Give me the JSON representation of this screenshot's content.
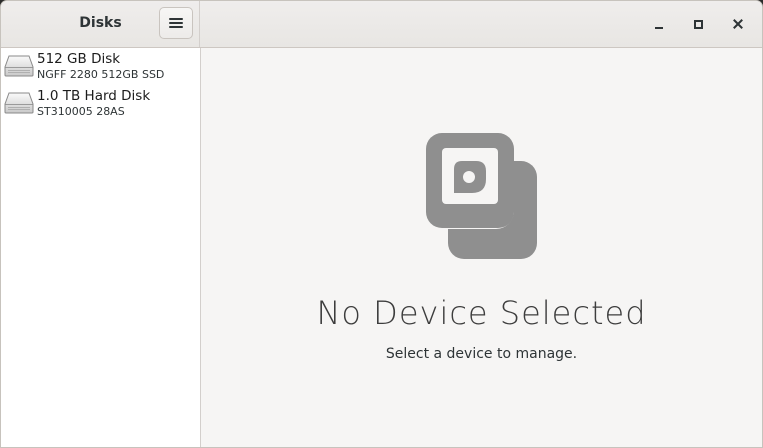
{
  "window": {
    "title": "Disks"
  },
  "header": {
    "menu_icon": "hamburger-menu-icon",
    "window_controls": [
      "minimize-icon",
      "maximize-icon",
      "close-icon"
    ]
  },
  "sidebar": {
    "disks": [
      {
        "name": "512 GB Disk",
        "model": "NGFF 2280 512GB SSD",
        "icon": "drive-harddisk-icon"
      },
      {
        "name": "1.0 TB Hard Disk",
        "model": "ST310005 28AS",
        "icon": "drive-harddisk-icon"
      }
    ]
  },
  "main": {
    "empty_state": {
      "icon": "disks-placeholder-icon",
      "title": "No Device Selected",
      "subtitle": "Select a device to manage."
    }
  },
  "colors": {
    "sidebar_bg": "#ffffff",
    "content_bg": "#f6f5f4",
    "header_bg": "#e8e6e3",
    "placeholder_icon": "#8f8f8f"
  }
}
